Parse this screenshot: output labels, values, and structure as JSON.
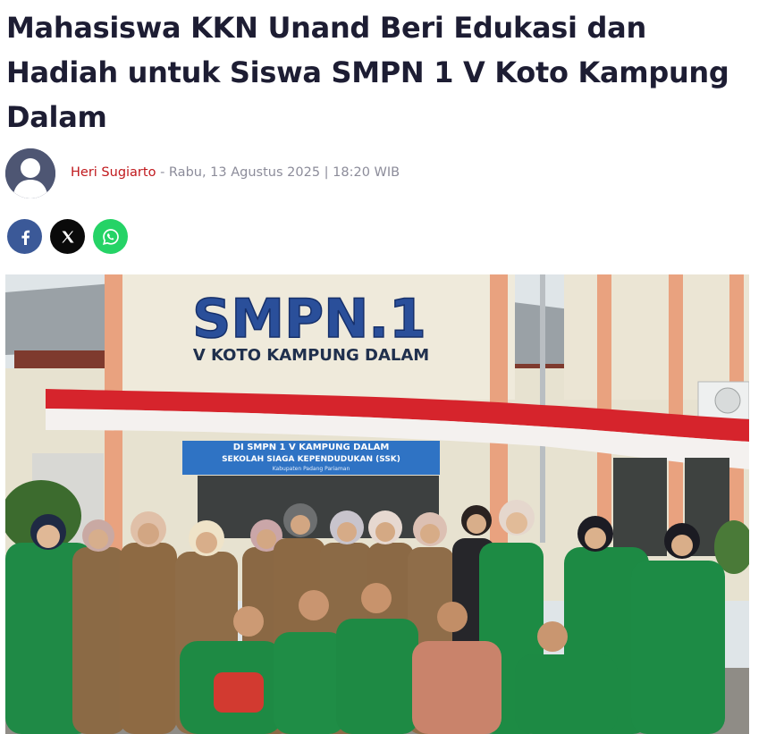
{
  "article": {
    "title": "Mahasiswa KKN Unand Beri Edukasi dan Hadiah untuk Siswa SMPN 1 V Koto Kampung Dalam",
    "author": "Heri Sugiarto",
    "separator": " - ",
    "date": "Rabu, 13 Agustus 2025 | 18:20 WIB",
    "author_color": "#c0181c"
  },
  "share": [
    {
      "name": "facebook",
      "icon": "facebook-icon",
      "color": "#3b5998"
    },
    {
      "name": "x",
      "icon": "x-icon",
      "color": "#0a0a0a"
    },
    {
      "name": "whatsapp",
      "icon": "whatsapp-icon",
      "color": "#25d366"
    }
  ],
  "photo": {
    "sign_main": "SMPN.1",
    "sign_sub": "V KOTO KAMPUNG DALAM",
    "banner_line1": "DI SMPN 1 V KAMPUNG DALAM",
    "banner_line2": "SEKOLAH SIAGA KEPENDUDUKAN (SSK)",
    "banner_line3": "Kabupaten Padang Pariaman"
  }
}
